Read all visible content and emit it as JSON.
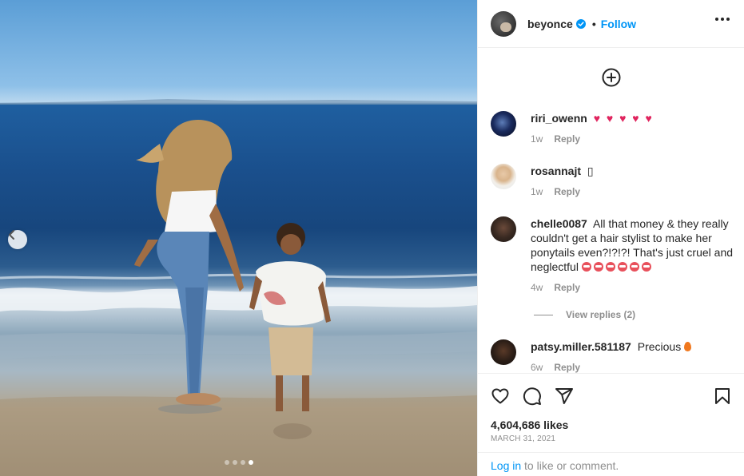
{
  "post": {
    "carousel": {
      "total": 4,
      "active_index": 3
    }
  },
  "header": {
    "username": "beyonce",
    "separator": "•",
    "follow_label": "Follow"
  },
  "comments": [
    {
      "username": "riri_owenn",
      "text": "♥ ♥ ♥ ♥ ♥",
      "age": "1w",
      "reply_label": "Reply"
    },
    {
      "username": "rosannajt",
      "text": "▯",
      "age": "1w",
      "reply_label": "Reply"
    },
    {
      "username": "chelle0087",
      "text": "All that money & they really couldn't get a hair stylist to make her ponytails even?!?!?! That's just cruel and neglectful",
      "age": "4w",
      "reply_label": "Reply"
    },
    {
      "username": "patsy.miller.581187",
      "text": "Precious",
      "age": "6w",
      "reply_label": "Reply"
    }
  ],
  "view_replies_label": "View replies (2)",
  "engagement": {
    "likes": "4,604,686 likes",
    "date": "MARCH 31, 2021"
  },
  "login_prompt": {
    "link": "Log in",
    "rest": " to like or comment."
  },
  "colors": {
    "accent": "#0095f6",
    "secondary_text": "#8e8e8e",
    "heart": "#e0245e"
  },
  "icons": [
    "chevron-left-icon",
    "add-circle-icon",
    "verified-badge-icon",
    "more-options-icon",
    "heart-icon",
    "comment-icon",
    "share-icon",
    "bookmark-icon"
  ]
}
